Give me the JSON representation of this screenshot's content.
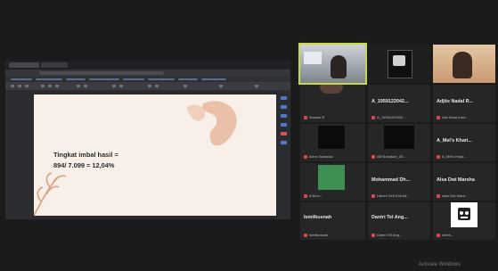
{
  "slide": {
    "line1": "Tingkat imbal hasil =",
    "line2": "894/ 7.099 = 12,04%"
  },
  "participants": [
    {
      "name": "",
      "sub": ""
    },
    {
      "name": "",
      "sub": ""
    },
    {
      "name": "",
      "sub": ""
    },
    {
      "name": "",
      "sub": "Susanti R"
    },
    {
      "name": "A_1959122042...",
      "sub": "A_19591220420..."
    },
    {
      "name": "Adjite Nadal R...",
      "sub": "Alta Ekaa Kant..."
    },
    {
      "name": "",
      "sub": "Alexs Saraswa"
    },
    {
      "name": "",
      "sub": "Alif Sutrakan_20..."
    },
    {
      "name": "A_Mel's Khari...",
      "sub": "A_Mel's Khair..."
    },
    {
      "name": "",
      "sub": "A Bom..."
    },
    {
      "name": "Mohammad Dh...",
      "sub": "Harsm Seif Kail Ad..."
    },
    {
      "name": "Alsa Dwi Marsha",
      "sub": "Alsa Dwi Mara..."
    },
    {
      "name": "Ismilkusnah",
      "sub": "Ismilkusnah"
    },
    {
      "name": "Dantri Tel Ang...",
      "sub": "Dantri Tel Ang..."
    },
    {
      "name": "",
      "sub": "Alexs..."
    }
  ],
  "watermark": "Activate Windows",
  "colors": {
    "active_speaker": "#c6d94a",
    "mic_muted": "#d34a4a",
    "green_tile": "#3d8f54"
  }
}
